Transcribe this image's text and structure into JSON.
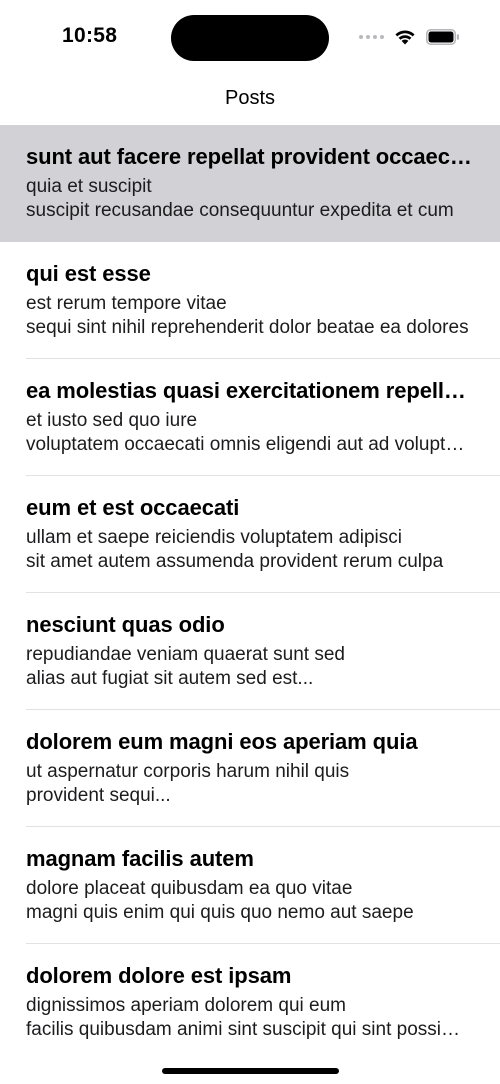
{
  "status_bar": {
    "time": "10:58"
  },
  "nav": {
    "title": "Posts"
  },
  "posts": [
    {
      "title": "sunt aut facere repellat provident occaecati excepturi optio reprehenderit",
      "body_line1": "quia et suscipit",
      "body_line2": "suscipit recusandae consequuntur expedita et cum"
    },
    {
      "title": "qui est esse",
      "body_line1": "est rerum tempore vitae",
      "body_line2": "sequi sint nihil reprehenderit dolor beatae ea dolores"
    },
    {
      "title": "ea molestias quasi exercitationem repellat qui ipsa sit aut",
      "body_line1": "et iusto sed quo iure",
      "body_line2": "voluptatem occaecati omnis eligendi aut ad voluptatem"
    },
    {
      "title": "eum et est occaecati",
      "body_line1": "ullam et saepe reiciendis voluptatem adipisci",
      "body_line2": "sit amet autem assumenda provident rerum culpa"
    },
    {
      "title": "nesciunt quas odio",
      "body_line1": "repudiandae veniam quaerat sunt sed",
      "body_line2": "alias aut fugiat sit autem sed est..."
    },
    {
      "title": "dolorem eum magni eos aperiam quia",
      "body_line1": "ut aspernatur corporis harum nihil quis",
      "body_line2": "provident sequi..."
    },
    {
      "title": "magnam facilis autem",
      "body_line1": "dolore placeat quibusdam ea quo vitae",
      "body_line2": "magni quis enim qui quis quo nemo aut saepe"
    },
    {
      "title": "dolorem dolore est ipsam",
      "body_line1": "dignissimos aperiam dolorem qui eum",
      "body_line2": "facilis quibusdam animi sint suscipit qui sint possimus"
    }
  ],
  "selected_index": 0,
  "colors": {
    "selected_row_bg": "#d1d1d6",
    "divider": "#e2e2e6",
    "text": "#000000"
  },
  "icons": {
    "signal": "cellular-signal-icon",
    "wifi": "wifi-icon",
    "battery": "battery-icon"
  }
}
